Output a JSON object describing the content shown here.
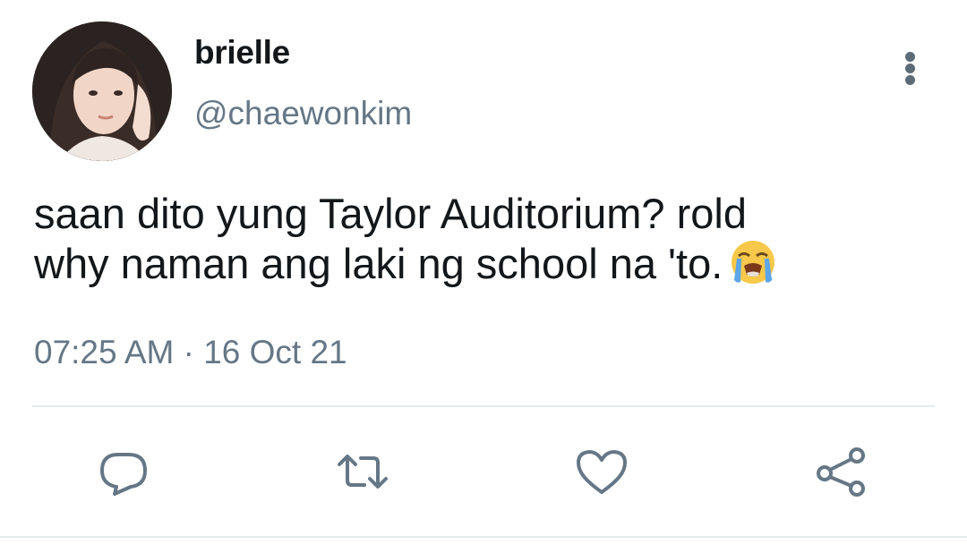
{
  "user": {
    "display_name": "brielle",
    "handle": "@chaewonkim",
    "avatar_icon": "profile-photo"
  },
  "tweet": {
    "text_lines": [
      "saan dito yung Taylor Auditorium? rold",
      "why naman ang laki ng school na 'to."
    ],
    "emoji": "loudly-crying-face",
    "timestamp": "07:25 AM · 16 Oct 21"
  },
  "actions": {
    "reply_icon": "reply-icon",
    "retweet_icon": "retweet-icon",
    "like_icon": "heart-icon",
    "share_icon": "share-icon",
    "more_icon": "more-vertical-icon"
  },
  "colors": {
    "text_primary": "#14171a",
    "text_secondary": "#657786",
    "icon": "#657786",
    "divider": "#e6ecf0"
  }
}
